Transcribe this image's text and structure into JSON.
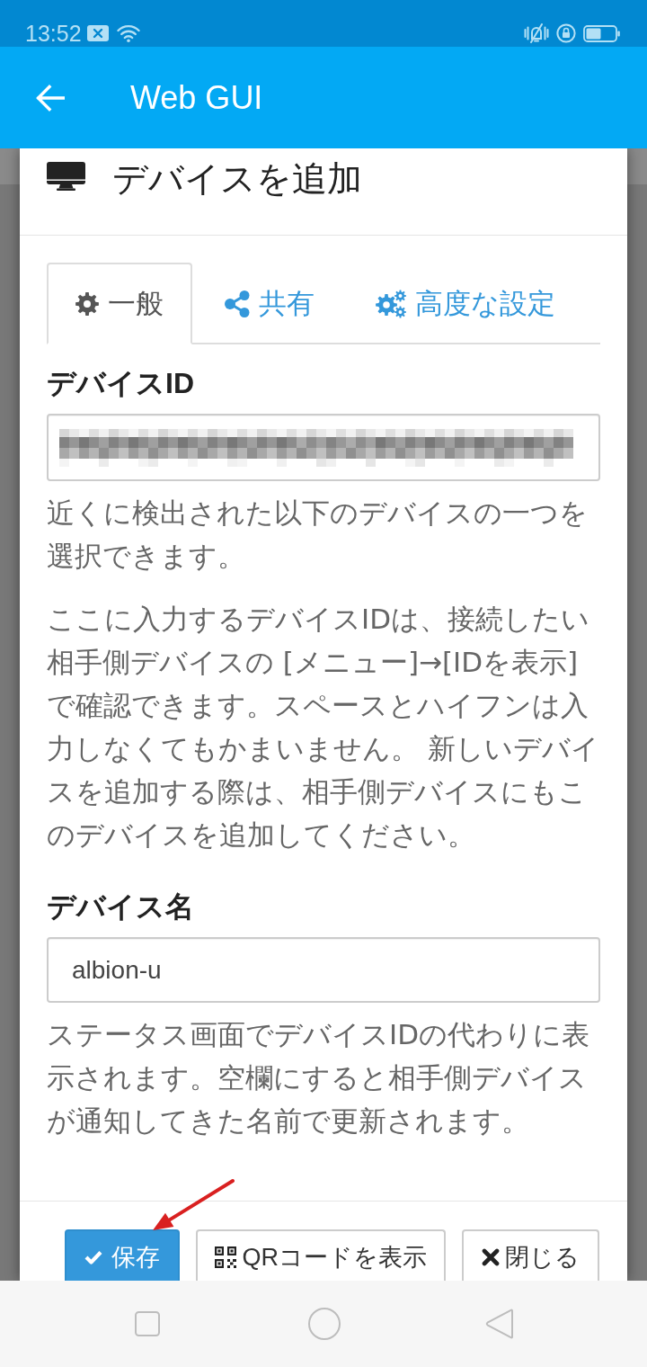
{
  "status_bar": {
    "time": "13:52"
  },
  "app_bar": {
    "title": "Web GUI"
  },
  "dialog": {
    "title": "デバイスを追加",
    "tabs": [
      {
        "label": "一般",
        "selected": true
      },
      {
        "label": "共有",
        "selected": false
      },
      {
        "label": "高度な設定",
        "selected": false
      }
    ],
    "fields": [
      {
        "label": "デバイスID",
        "redacted": true,
        "help": [
          "近くに検出された以下のデバイスの一つを選択できます。",
          "ここに入力するデバイスIDは、接続したい相手側デバイスの [メニュー]→[IDを表示]で確認できます。スペースとハイフンは入力しなくてもかまいません。 新しいデバイスを追加する際は、相手側デバイスにもこのデバイスを追加してください。"
        ]
      },
      {
        "label": "デバイス名",
        "value": "albion-u",
        "redacted": false,
        "help": [
          "ステータス画面でデバイスIDの代わりに表示されます。空欄にすると相手側デバイスが通知してきた名前で更新されます。"
        ]
      }
    ],
    "buttons": [
      {
        "label": "保存",
        "kind": "primary"
      },
      {
        "label": "QRコードを表示",
        "kind": "default"
      },
      {
        "label": "閉じる",
        "kind": "default"
      }
    ]
  }
}
